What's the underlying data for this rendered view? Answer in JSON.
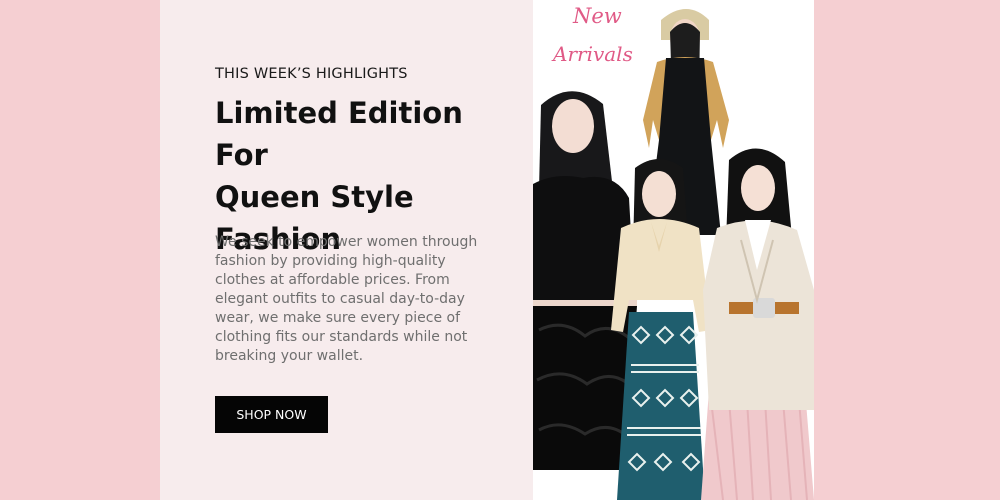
{
  "hero": {
    "eyebrow": "THIS WEEK’S HIGHLIGHTS",
    "headline_lines": [
      "Limited Edition For",
      "Queen Style",
      "Fashion"
    ],
    "body": "We seek to empower women through fashion by providing high-quality clothes at affordable prices. From elegant outfits to casual day-to-day wear, we make sure every piece of clothing fits our standards while not breaking your wallet.",
    "cta_label": "SHOP NOW"
  },
  "photo": {
    "script_line1": "New",
    "script_line2": "Arrivals"
  },
  "colors": {
    "page_background": "#f5cfd2",
    "text_panel_background": "#f7eced",
    "button_background": "#050505",
    "script_pink": "#e05a86"
  }
}
